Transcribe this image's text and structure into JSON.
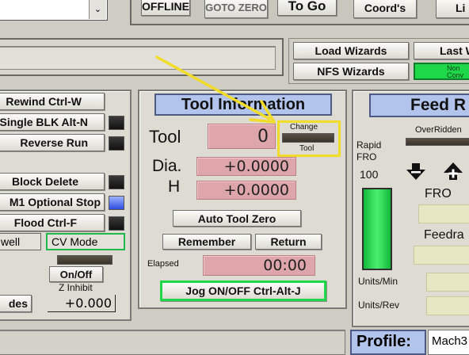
{
  "toolbar": {
    "offline": "OFFLINE",
    "goto_zero": "GOTO ZERO",
    "to_go": "To Go",
    "coords": "Coord's",
    "limits": "Li"
  },
  "wizards": {
    "load": "Load Wizards",
    "last": "Last W",
    "nfs": "NFS Wizards",
    "green_line1": "Non",
    "green_line2": "Conv"
  },
  "left_panel": {
    "rewind": "Rewind Ctrl-W",
    "single_blk": "Single BLK Alt-N",
    "reverse_run": "Reverse Run",
    "block_delete": "Block Delete",
    "optional_stop": "M1 Optional Stop",
    "flood": "Flood Ctrl-F",
    "dwell": "well",
    "cv_mode": "CV Mode",
    "on_off": "On/Off",
    "z_inhibit": "Z Inhibit",
    "modes": "des",
    "z_inhibit_value": "+0.000"
  },
  "tool_info": {
    "title": "Tool Information",
    "tool_label": "Tool",
    "tool_value": "0",
    "change_top": "Change",
    "change_bottom": "Tool",
    "dia_label": "Dia.",
    "dia_value": "+0.0000",
    "h_label": "H",
    "h_value": "+0.0000",
    "auto_tool_zero": "Auto Tool Zero",
    "remember": "Remember",
    "return": "Return",
    "elapsed_label": "Elapsed",
    "elapsed_value": "00:00",
    "jog": "Jog ON/OFF Ctrl-Alt-J"
  },
  "feed": {
    "title": "Feed R",
    "overridden": "OverRidden",
    "rapid_line1": "Rapid",
    "rapid_line2": "FRO",
    "rapid_value": "100",
    "fro": "FRO",
    "feedrate": "Feedra",
    "units_min": "Units/Min",
    "units_rev": "Units/Rev"
  },
  "status": {
    "profile_label": "Profile:",
    "profile_value": "Mach3"
  },
  "colors": {
    "annotation": "#f2dc2a",
    "dro": "#dea5ab",
    "header": "#b3c4ec",
    "green": "#1fd84a"
  }
}
